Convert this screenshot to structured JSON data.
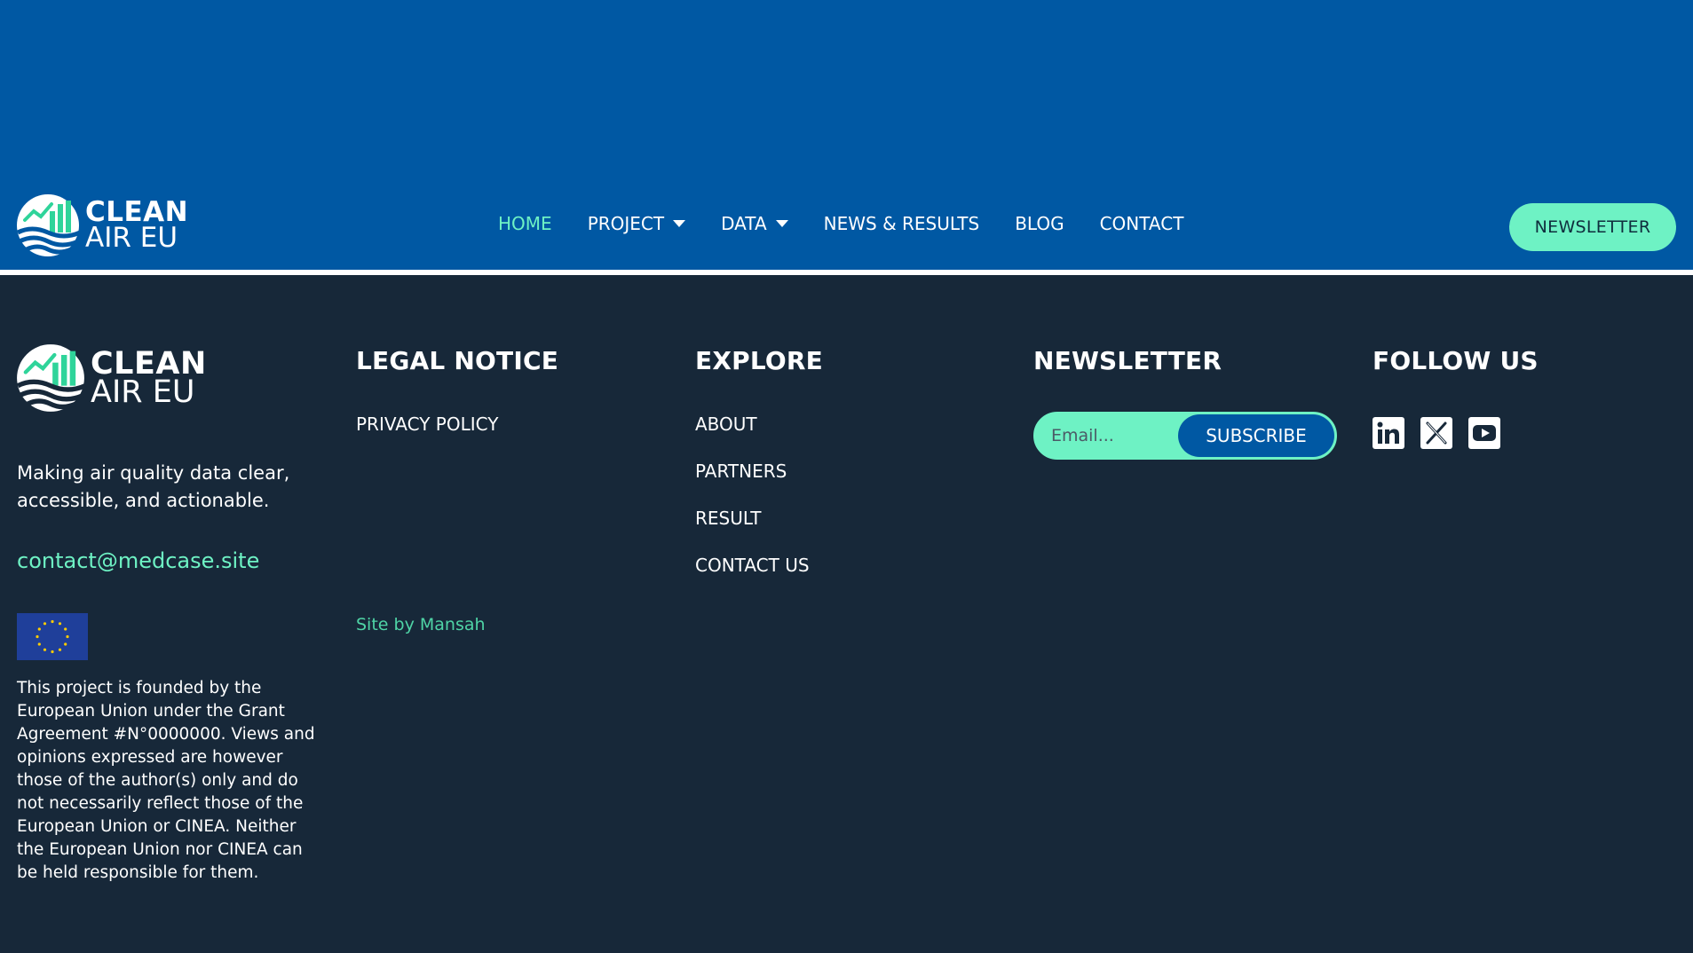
{
  "header": {
    "logo": {
      "line1": "CLEAN",
      "line2": "AIR EU"
    },
    "nav": [
      {
        "label": "HOME",
        "active": true
      },
      {
        "label": "PROJECT",
        "dropdown": true
      },
      {
        "label": "DATA",
        "dropdown": true
      },
      {
        "label": "NEWS & RESULTS"
      },
      {
        "label": "BLOG"
      },
      {
        "label": "CONTACT"
      }
    ],
    "newsletter_button": "NEWSLETTER"
  },
  "footer": {
    "logo": {
      "line1": "CLEAN",
      "line2": "AIR EU"
    },
    "tagline": "Making air quality data clear, accessible, and actionable.",
    "email": "contact@medcase.site",
    "disclaimer": "This project is founded by the European Union under the Grant Agreement #N°0000000. Views and opinions expressed are however those of the author(s) only and do not necessarily reflect those of the European Union or CINEA. Neither the European Union nor CINEA can be held responsible for them.",
    "legal": {
      "heading": "LEGAL NOTICE",
      "links": [
        "PRIVACY POLICY"
      ],
      "site_by": "Site by Mansah"
    },
    "explore": {
      "heading": "EXPLORE",
      "links": [
        "ABOUT",
        "PARTNERS",
        "RESULT",
        "CONTACT US"
      ]
    },
    "newsletter": {
      "heading": "NEWSLETTER",
      "placeholder": "Email...",
      "subscribe": "SUBSCRIBE"
    },
    "follow": {
      "heading": "FOLLOW US",
      "icons": [
        "linkedin-icon",
        "x-icon",
        "youtube-icon"
      ]
    }
  },
  "colors": {
    "header_bg": "#0058a3",
    "footer_bg": "#172839",
    "accent": "#6ef2c4",
    "eu_flag": "#1f3f9a",
    "eu_star": "#ffcc00"
  }
}
